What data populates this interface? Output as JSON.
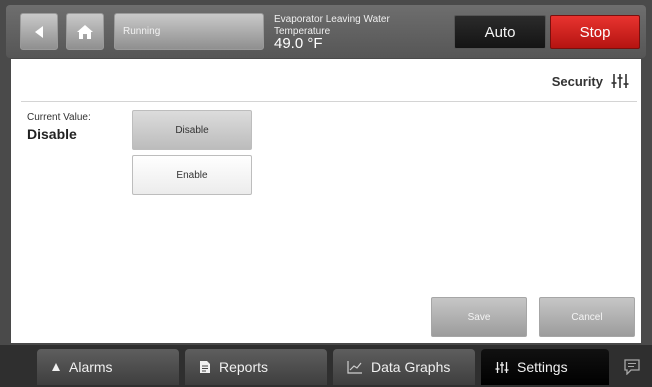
{
  "header": {
    "status": "Running",
    "ewt_label": "Evaporator Leaving Water Temperature",
    "ewt_value": "49.0 °F",
    "auto_label": "Auto",
    "stop_label": "Stop"
  },
  "panel": {
    "title": "Security",
    "current_value_label": "Current Value:",
    "current_value": "Disable",
    "options": [
      "Disable",
      "Enable"
    ],
    "save_label": "Save",
    "cancel_label": "Cancel"
  },
  "nav": {
    "tabs": [
      {
        "label": "Alarms",
        "icon": "bell-icon"
      },
      {
        "label": "Reports",
        "icon": "document-icon"
      },
      {
        "label": "Data Graphs",
        "icon": "line-chart-icon"
      },
      {
        "label": "Settings",
        "icon": "sliders-icon"
      }
    ],
    "active": "Settings"
  },
  "colors": {
    "stop": "#d5221e",
    "auto": "#1a1a1a",
    "header": "#5e5e5e"
  }
}
